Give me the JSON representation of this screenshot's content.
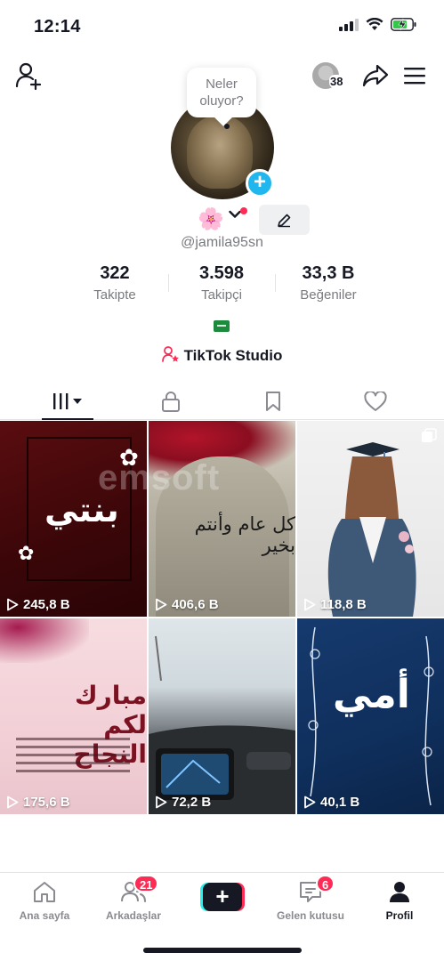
{
  "status_bar": {
    "time": "12:14"
  },
  "header": {
    "views_count": "38"
  },
  "profile": {
    "bubble_text": "Neler\nolyor?",
    "bubble_line1": "Neler",
    "bubble_line2": "oluyor?",
    "username": "@jamila95sn",
    "flower_emoji": "🌸",
    "stats": [
      {
        "value": "322",
        "label": "Takipte"
      },
      {
        "value": "3.598",
        "label": "Takipçi"
      },
      {
        "value": "33,3 B",
        "label": "Beğeniler"
      }
    ],
    "studio_label": "TikTok Studio"
  },
  "tabs": [
    "videos-tab",
    "private-tab",
    "saved-tab",
    "liked-tab"
  ],
  "videos": [
    {
      "views": "245,8 B",
      "caption": "بنتي"
    },
    {
      "views": "406,6 B",
      "caption": "كل عام وأنتم بخير"
    },
    {
      "views": "118,8 B",
      "caption": ""
    },
    {
      "views": "175,6 B",
      "caption": "مبارك لكم النجاح"
    },
    {
      "views": "72,2 B",
      "caption": ""
    },
    {
      "views": "40,1 B",
      "caption": "أمي"
    }
  ],
  "watermark": "emsoft",
  "bottom_nav": [
    {
      "label": "Ana sayfa",
      "badge": ""
    },
    {
      "label": "Arkadaşlar",
      "badge": "21"
    },
    {
      "label": "",
      "badge": ""
    },
    {
      "label": "Gelen kutusu",
      "badge": "6"
    },
    {
      "label": "Profil",
      "badge": ""
    }
  ],
  "colors": {
    "accent_red": "#fe2c55",
    "accent_cyan": "#25f4ee",
    "plus_blue": "#20b7ef",
    "text_dark": "#161823",
    "text_grey": "#7a7b80"
  }
}
